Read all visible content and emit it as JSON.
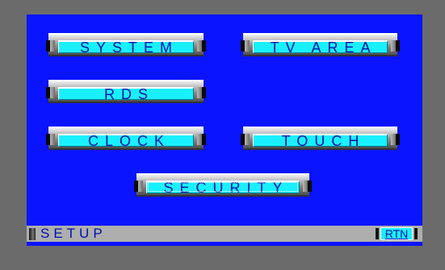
{
  "menu": {
    "buttons": {
      "system": "SYSTEM",
      "tv_area": "TV AREA",
      "rds": "RDS",
      "clock": "CLOCK",
      "touch": "TOUCH",
      "security": "SECURITY"
    },
    "selected": "security"
  },
  "status_bar": {
    "title": "SETUP",
    "return_label": "RTN"
  },
  "colors": {
    "frame": "#6b6b6b",
    "screen_background": "#0a14ff",
    "button_face": "#19f0ff",
    "button_text": "#0011aa",
    "status_bar": "#aeaeae"
  }
}
